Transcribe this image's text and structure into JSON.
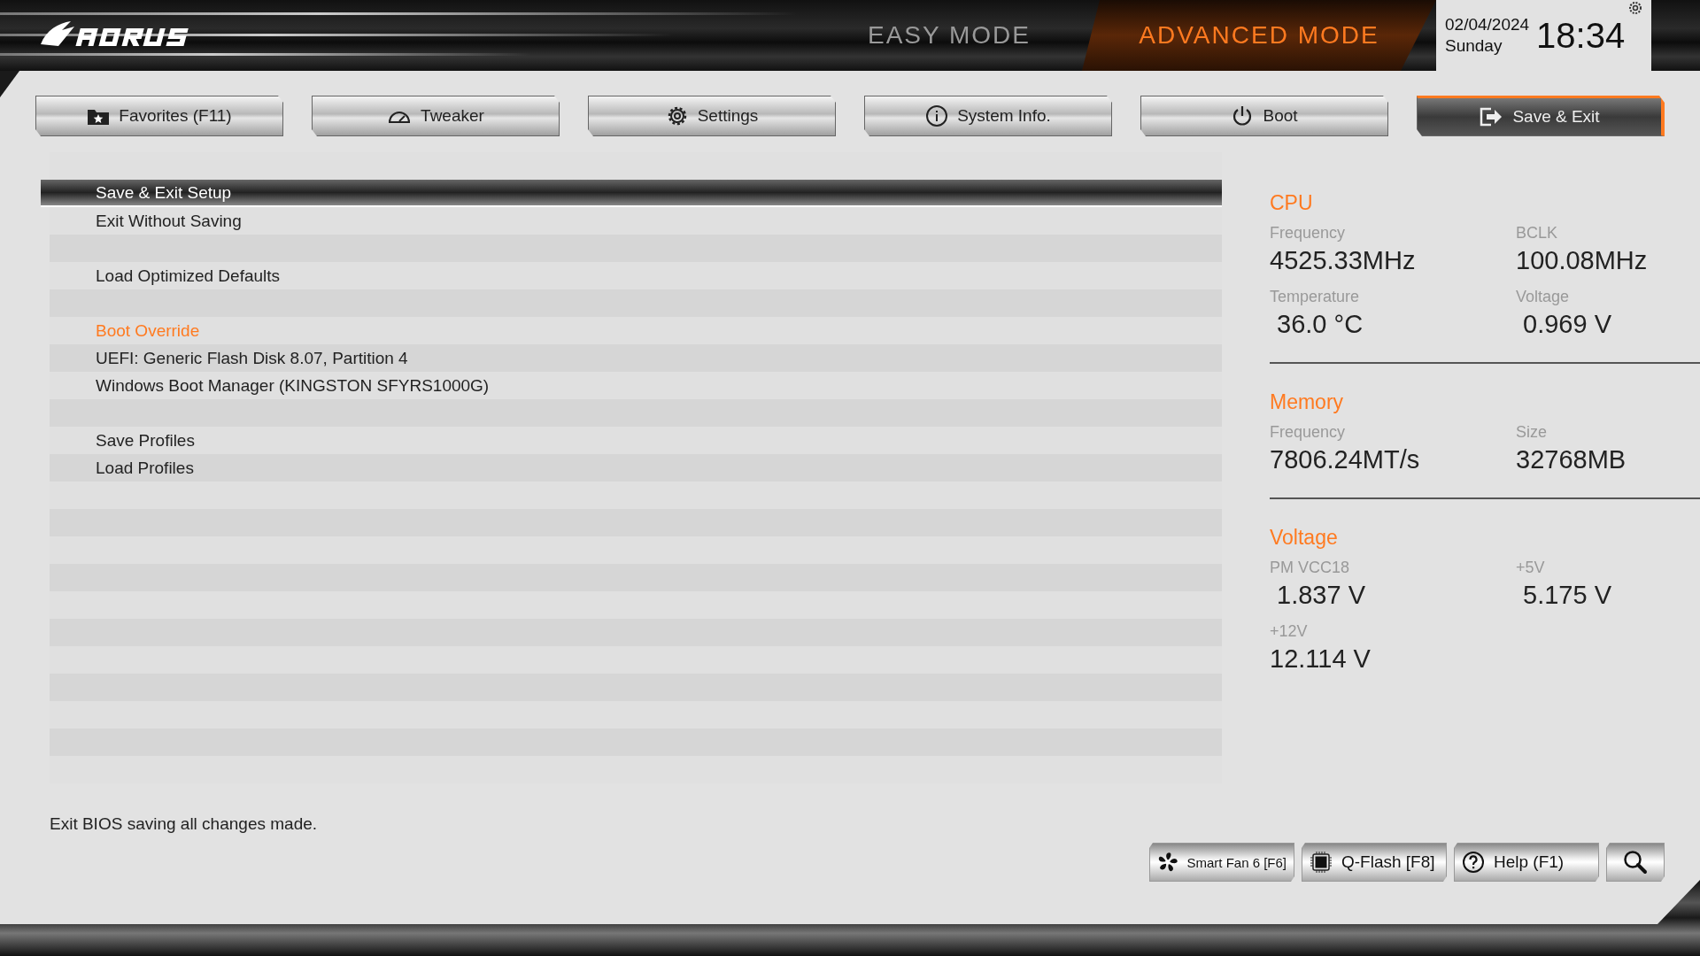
{
  "header": {
    "modes": [
      {
        "label": "EASY MODE",
        "selected": false
      },
      {
        "label": "ADVANCED MODE",
        "selected": true
      }
    ],
    "date": "02/04/2024",
    "day": "Sunday",
    "time": "18:34"
  },
  "tabs": [
    {
      "label": "Favorites (F11)",
      "selected": false
    },
    {
      "label": "Tweaker",
      "selected": false
    },
    {
      "label": "Settings",
      "selected": false
    },
    {
      "label": "System Info.",
      "selected": false
    },
    {
      "label": "Boot",
      "selected": false
    },
    {
      "label": "Save & Exit",
      "selected": true
    }
  ],
  "menu": [
    {
      "kind": "spacer"
    },
    {
      "kind": "item",
      "label": "Save & Exit Setup",
      "selected": true
    },
    {
      "kind": "item",
      "label": "Exit Without Saving",
      "selected": false
    },
    {
      "kind": "spacer"
    },
    {
      "kind": "item",
      "label": "Load Optimized Defaults",
      "selected": false
    },
    {
      "kind": "spacer"
    },
    {
      "kind": "header",
      "label": "Boot Override"
    },
    {
      "kind": "item",
      "label": "UEFI: Generic Flash Disk 8.07, Partition 4",
      "selected": false
    },
    {
      "kind": "item",
      "label": "Windows Boot Manager (KINGSTON SFYRS1000G)",
      "selected": false
    },
    {
      "kind": "spacer"
    },
    {
      "kind": "item",
      "label": "Save Profiles",
      "selected": false
    },
    {
      "kind": "item",
      "label": "Load Profiles",
      "selected": false
    }
  ],
  "info_panel": [
    {
      "title": "CPU",
      "readings": [
        {
          "label": "Frequency",
          "value": "4525.33MHz"
        },
        {
          "label": "BCLK",
          "value": "100.08MHz"
        },
        {
          "label": "Temperature",
          "value": " 36.0 °C"
        },
        {
          "label": "Voltage",
          "value": " 0.969 V"
        }
      ]
    },
    {
      "title": "Memory",
      "readings": [
        {
          "label": "Frequency",
          "value": "7806.24MT/s"
        },
        {
          "label": "Size",
          "value": "32768MB"
        }
      ]
    },
    {
      "title": "Voltage",
      "readings": [
        {
          "label": "PM VCC18",
          "value": " 1.837 V"
        },
        {
          "label": "+5V",
          "value": " 5.175 V"
        },
        {
          "label": "+12V",
          "value": "12.114 V"
        }
      ]
    }
  ],
  "description": "Exit BIOS saving all changes made.",
  "bottom_buttons": [
    {
      "kind": "labeled",
      "label": "Smart Fan 6 [F6]"
    },
    {
      "kind": "labeled",
      "label": "Q-Flash [F8]"
    },
    {
      "kind": "labeled",
      "label": "Help (F1)"
    },
    {
      "kind": "icon"
    }
  ]
}
